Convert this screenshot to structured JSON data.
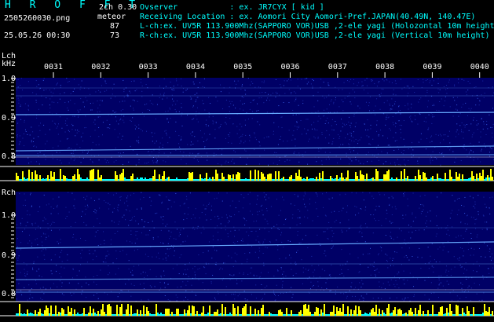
{
  "header": {
    "app_title": "H R O F F T",
    "mode": "2ch 0.30",
    "filename": "2505260030.png",
    "meteor_label": "meteor",
    "lch_count": "87",
    "rch_count": "73",
    "datetime": "25.05.26 00:30",
    "observer_line": "Ovserver           : ex. JR7CYX [ kid ]",
    "location_line": "Receiving Location : ex. Aomori City Aomori-Pref.JAPAN(40.49N, 140.47E)",
    "lch_line": "L-ch:ex. UV5R 113.900Mhz(SAPPORO VOR)USB ,2-ele yagi (Holozontal 10m height)",
    "rch_line": "R-ch:ex. UV5R 113.900Mhz(SAPPORO VOR)USB ,2-ele yagi (Vertical 10m height)"
  },
  "time_axis": [
    "0031",
    "0032",
    "0033",
    "0034",
    "0035",
    "0036",
    "0037",
    "0038",
    "0039",
    "0040"
  ],
  "lch_panel": {
    "label": "Lch",
    "unit": "kHz",
    "ticks": [
      "1.0",
      "0.9",
      "0.8"
    ]
  },
  "rch_panel": {
    "label": "Rch",
    "ticks": [
      "1.0",
      "0.9",
      "0.8"
    ]
  },
  "colors": {
    "background": "#000000",
    "spectrum_bg": "#000066",
    "carrier": "#66aaff",
    "activity_yellow": "#ffff00",
    "activity_cyan": "#00ffff",
    "label_cyan": "#00ffff"
  }
}
